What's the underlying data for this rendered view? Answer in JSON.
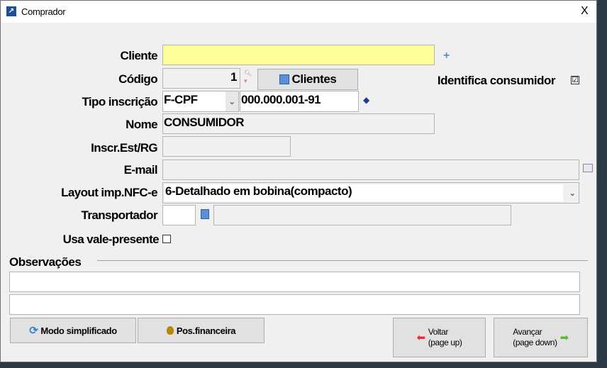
{
  "window": {
    "title": "Comprador",
    "close": "X"
  },
  "form": {
    "cliente": {
      "label": "Cliente",
      "value": ""
    },
    "codigo": {
      "label": "Código",
      "value": "1"
    },
    "clientes_button": "Clientes",
    "identifica": {
      "label": "Identifica consumidor",
      "checked": true,
      "mark": "☑"
    },
    "tipo": {
      "label": "Tipo inscrição",
      "value": "F-CPF",
      "doc": "000.000.001-91"
    },
    "nome": {
      "label": "Nome",
      "value": "CONSUMIDOR"
    },
    "inscr": {
      "label": "Inscr.Est/RG",
      "value": ""
    },
    "email": {
      "label": "E-mail",
      "value": ""
    },
    "layout": {
      "label": "Layout imp.NFC-e",
      "value": "6-Detalhado em bobina(compacto)"
    },
    "transportador": {
      "label": "Transportador",
      "code": "",
      "name": ""
    },
    "vale": {
      "label": "Usa vale-presente",
      "checked": false
    },
    "observacoes": {
      "label": "Observações",
      "line1": "",
      "line2": ""
    }
  },
  "buttons": {
    "modo": "Modo simplificado",
    "pos": "Pos.financeira",
    "voltar": "Voltar",
    "voltar_sub": "(page up)",
    "avancar": "Avançar",
    "avancar_sub": "(page down)"
  }
}
